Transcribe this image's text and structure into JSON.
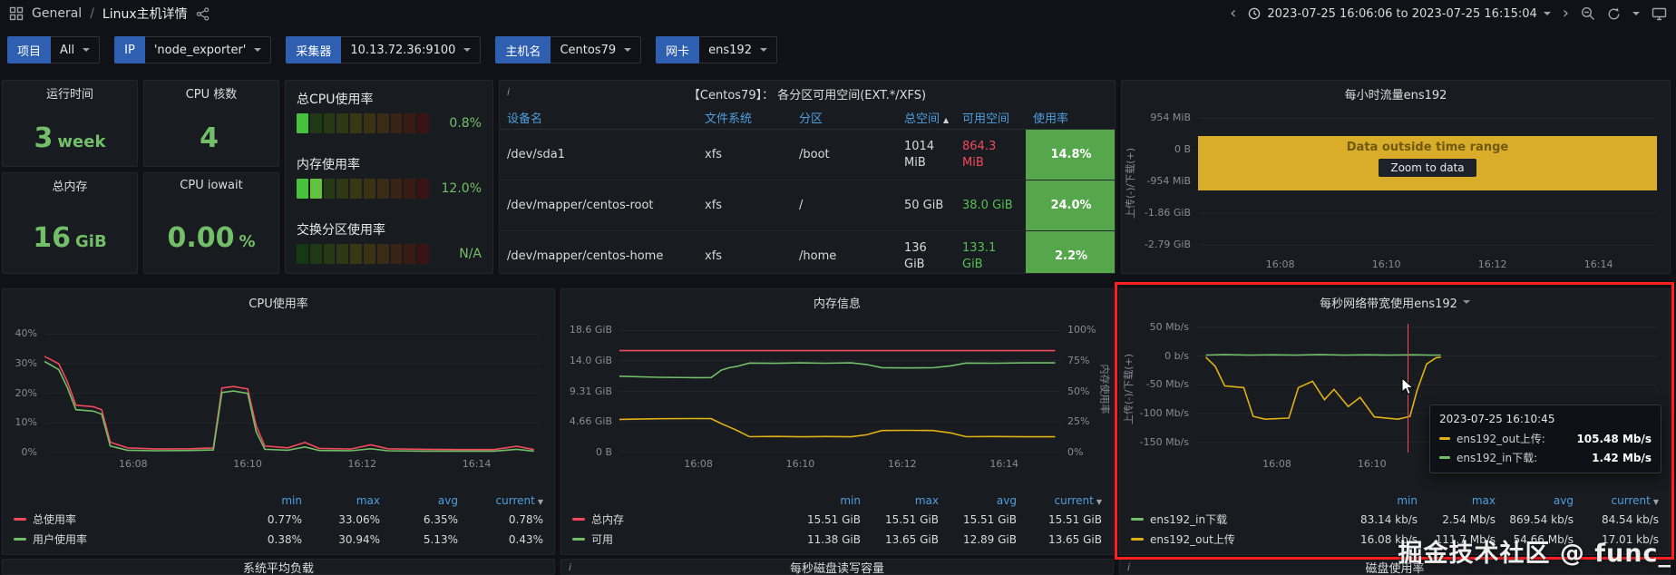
{
  "colors": {
    "red": "#f2495c",
    "green": "#73bf69",
    "yellow": "#e0b015",
    "value_green": "#56bf53",
    "value_red": "#f2495c",
    "usage_bg": "#56a64b",
    "header_blue": "#4f9ede",
    "filter_label_bg": "#2e5fb0",
    "band_bg": "#d9ad29",
    "highlight_red": "#ff1f1f"
  },
  "topbar": {
    "section": "General",
    "sep": "/",
    "page": "Linux主机详情",
    "time_range": "2023-07-25 16:06:06 to 2023-07-25 16:15:04"
  },
  "filters": [
    {
      "label": "项目",
      "value": "All"
    },
    {
      "label": "IP",
      "value": "'node_exporter'"
    },
    {
      "label": "采集器",
      "value": "10.13.72.36:9100"
    },
    {
      "label": "主机名",
      "value": "Centos79"
    },
    {
      "label": "网卡",
      "value": "ens192"
    }
  ],
  "stats": [
    {
      "title": "运行时间",
      "value": "3",
      "unit": "week"
    },
    {
      "title": "CPU 核数",
      "value": "4",
      "unit": ""
    },
    {
      "title": "总内存",
      "value": "16",
      "unit": "GiB"
    },
    {
      "title": "CPU iowait",
      "value": "0.00",
      "unit": "%"
    }
  ],
  "gauges": {
    "rows": [
      {
        "title": "总CPU使用率",
        "value": "0.8%",
        "pct": 0.8
      },
      {
        "title": "内存使用率",
        "value": "12.0%",
        "pct": 12.0
      },
      {
        "title": "交换分区使用率",
        "value": "N/A",
        "pct": 0
      }
    ]
  },
  "disk_table": {
    "title": "【Centos79】： 各分区可用空间(EXT.*/XFS)",
    "columns": [
      "设备名",
      "文件系统",
      "分区",
      "总空间",
      "可用空间",
      "使用率"
    ],
    "sorted_column_index": 3,
    "rows": [
      {
        "device": "/dev/sda1",
        "fs": "xfs",
        "mount": "/boot",
        "total": "1014 MiB",
        "avail": "864.3 MiB",
        "avail_color": "red",
        "usage": "14.8%"
      },
      {
        "device": "/dev/mapper/centos-root",
        "fs": "xfs",
        "mount": "/",
        "total": "50 GiB",
        "avail": "38.0 GiB",
        "avail_color": "green",
        "usage": "24.0%"
      },
      {
        "device": "/dev/mapper/centos-home",
        "fs": "xfs",
        "mount": "/home",
        "total": "136 GiB",
        "avail": "133.1 GiB",
        "avail_color": "green",
        "usage": "2.2%"
      }
    ]
  },
  "hourly_panel": {
    "title": "每小时流量ens192",
    "axis_label": "上传(-)/下载(+)",
    "overlay": {
      "message": "Data outside time range",
      "button": "Zoom to data"
    },
    "chart": {
      "type": "line",
      "x_range": [
        6.45,
        15.1
      ],
      "y_range": [
        -3100,
        1150
      ],
      "y_ticks": [
        {
          "label": "954 MiB",
          "v": 954
        },
        {
          "label": "0 B",
          "v": 0
        },
        {
          "label": "-954 MiB",
          "v": -954
        },
        {
          "label": "-1.86 GiB",
          "v": -1905
        },
        {
          "label": "-2.79 GiB",
          "v": -2857
        }
      ],
      "x_ticks": [
        {
          "label": "16:08",
          "v": 8
        },
        {
          "label": "16:10",
          "v": 10
        },
        {
          "label": "16:12",
          "v": 12
        },
        {
          "label": "16:14",
          "v": 14
        }
      ],
      "series": []
    }
  },
  "cpu_panel": {
    "title": "CPU使用率",
    "legend_columns": [
      "min",
      "max",
      "avg",
      "current"
    ],
    "legend": [
      {
        "name": "总使用率",
        "color": "red",
        "values": [
          "0.77%",
          "33.06%",
          "6.35%",
          "0.78%"
        ]
      },
      {
        "name": "用户使用率",
        "color": "green",
        "values": [
          "0.38%",
          "30.94%",
          "5.13%",
          "0.43%"
        ]
      }
    ],
    "chart": {
      "type": "line",
      "x_range": [
        6.45,
        15.1
      ],
      "y_range": [
        0,
        43.5
      ],
      "y_ticks": [
        {
          "label": "40%",
          "v": 40
        },
        {
          "label": "30%",
          "v": 30
        },
        {
          "label": "20%",
          "v": 20
        },
        {
          "label": "10%",
          "v": 10
        },
        {
          "label": "0%",
          "v": 0
        }
      ],
      "x_ticks": [
        {
          "label": "16:08",
          "v": 8
        },
        {
          "label": "16:10",
          "v": 10
        },
        {
          "label": "16:12",
          "v": 12
        },
        {
          "label": "16:14",
          "v": 14
        }
      ],
      "series": [
        {
          "color": "red",
          "points": [
            [
              6.45,
              32.5
            ],
            [
              6.7,
              30
            ],
            [
              6.85,
              24
            ],
            [
              7.0,
              16
            ],
            [
              7.3,
              15.5
            ],
            [
              7.45,
              14.5
            ],
            [
              7.6,
              3.5
            ],
            [
              7.9,
              1.6
            ],
            [
              8.4,
              1.2
            ],
            [
              9.0,
              1.3
            ],
            [
              9.4,
              1.6
            ],
            [
              9.55,
              21.8
            ],
            [
              9.75,
              22.3
            ],
            [
              10.0,
              21.5
            ],
            [
              10.15,
              9
            ],
            [
              10.3,
              2.2
            ],
            [
              10.7,
              1.6
            ],
            [
              11.0,
              3.4
            ],
            [
              11.25,
              1.4
            ],
            [
              11.8,
              1.2
            ],
            [
              12.15,
              2.6
            ],
            [
              12.45,
              1.3
            ],
            [
              13.1,
              1.1
            ],
            [
              13.7,
              1.0
            ],
            [
              14.3,
              1.0
            ],
            [
              14.7,
              2.1
            ],
            [
              15.0,
              1.0
            ]
          ]
        },
        {
          "color": "green",
          "points": [
            [
              6.45,
              30.8
            ],
            [
              6.7,
              28
            ],
            [
              6.85,
              22
            ],
            [
              7.0,
              14.5
            ],
            [
              7.3,
              14
            ],
            [
              7.45,
              13
            ],
            [
              7.6,
              2.2
            ],
            [
              7.9,
              0.8
            ],
            [
              8.4,
              0.6
            ],
            [
              9.0,
              0.7
            ],
            [
              9.4,
              0.9
            ],
            [
              9.55,
              20.3
            ],
            [
              9.75,
              20.8
            ],
            [
              10.0,
              20
            ],
            [
              10.15,
              7
            ],
            [
              10.3,
              1.1
            ],
            [
              10.7,
              0.8
            ],
            [
              11.0,
              1.9
            ],
            [
              11.25,
              0.7
            ],
            [
              11.8,
              0.6
            ],
            [
              12.15,
              1.3
            ],
            [
              12.45,
              0.6
            ],
            [
              13.1,
              0.5
            ],
            [
              13.7,
              0.5
            ],
            [
              14.3,
              0.5
            ],
            [
              14.7,
              1.1
            ],
            [
              15.0,
              0.5
            ]
          ]
        }
      ]
    }
  },
  "mem_panel": {
    "title": "内存信息",
    "y2_label": "内存使用率",
    "legend_columns": [
      "min",
      "max",
      "avg",
      "current"
    ],
    "legend": [
      {
        "name": "总内存",
        "color": "red",
        "values": [
          "15.51 GiB",
          "15.51 GiB",
          "15.51 GiB",
          "15.51 GiB"
        ]
      },
      {
        "name": "可用",
        "color": "green",
        "values": [
          "11.38 GiB",
          "13.65 GiB",
          "12.89 GiB",
          "13.65 GiB"
        ]
      }
    ],
    "chart": {
      "type": "line",
      "x_range": [
        6.45,
        15.1
      ],
      "y_range": [
        0,
        19.6
      ],
      "y_ticks": [
        {
          "label": "18.6 GiB",
          "v": 18.62
        },
        {
          "label": "14.0 GiB",
          "v": 13.97
        },
        {
          "label": "9.31 GiB",
          "v": 9.31
        },
        {
          "label": "4.66 GiB",
          "v": 4.66
        },
        {
          "label": "0 B",
          "v": 0
        }
      ],
      "y2_ticks": [
        "100%",
        "75%",
        "50%",
        "25%",
        "0%"
      ],
      "x_ticks": [
        {
          "label": "16:08",
          "v": 8
        },
        {
          "label": "16:10",
          "v": 10
        },
        {
          "label": "16:12",
          "v": 12
        },
        {
          "label": "16:14",
          "v": 14
        }
      ],
      "series": [
        {
          "color": "red",
          "points": [
            [
              6.45,
              15.51
            ],
            [
              15.0,
              15.51
            ]
          ]
        },
        {
          "color": "green",
          "points": [
            [
              6.45,
              11.62
            ],
            [
              7.2,
              11.45
            ],
            [
              7.9,
              11.4
            ],
            [
              8.25,
              11.42
            ],
            [
              8.45,
              12.55
            ],
            [
              8.6,
              12.9
            ],
            [
              8.75,
              13.1
            ],
            [
              9.0,
              13.62
            ],
            [
              9.5,
              13.58
            ],
            [
              10.0,
              13.65
            ],
            [
              10.5,
              13.6
            ],
            [
              11.0,
              13.65
            ],
            [
              11.3,
              13.4
            ],
            [
              11.6,
              12.92
            ],
            [
              12.1,
              12.88
            ],
            [
              12.6,
              12.9
            ],
            [
              12.95,
              13.2
            ],
            [
              13.25,
              13.62
            ],
            [
              13.8,
              13.6
            ],
            [
              14.4,
              13.65
            ],
            [
              15.0,
              13.65
            ]
          ]
        },
        {
          "color": "yellow",
          "points": [
            [
              6.45,
              5.05
            ],
            [
              7.2,
              5.15
            ],
            [
              7.9,
              5.18
            ],
            [
              8.25,
              5.16
            ],
            [
              8.45,
              4.4
            ],
            [
              8.6,
              3.9
            ],
            [
              8.75,
              3.4
            ],
            [
              9.0,
              2.42
            ],
            [
              9.5,
              2.46
            ],
            [
              10.0,
              2.4
            ],
            [
              10.5,
              2.44
            ],
            [
              11.0,
              2.4
            ],
            [
              11.3,
              2.7
            ],
            [
              11.6,
              3.35
            ],
            [
              12.1,
              3.38
            ],
            [
              12.6,
              3.35
            ],
            [
              12.95,
              3.0
            ],
            [
              13.25,
              2.42
            ],
            [
              13.8,
              2.45
            ],
            [
              14.4,
              2.4
            ],
            [
              15.0,
              2.4
            ]
          ]
        }
      ]
    }
  },
  "net_panel": {
    "title": "每秒网络带宽使用ens192",
    "axis_label": "上传(-)/下载(+)",
    "legend_columns": [
      "min",
      "max",
      "avg",
      "current"
    ],
    "legend": [
      {
        "name": "ens192_in下载",
        "color": "green",
        "values": [
          "83.14 kb/s",
          "2.54 Mb/s",
          "869.54 kb/s",
          "84.54 kb/s"
        ]
      },
      {
        "name": "ens192_out上传",
        "color": "yellow",
        "values": [
          "16.08 kb/s",
          "111.7 Mb/s",
          "54.66 Mb/s",
          "17.01 kb/s"
        ]
      }
    ],
    "tooltip": {
      "time": "2023-07-25 16:10:45",
      "rows": [
        {
          "name": "ens192_out上传:",
          "value": "105.48 Mb/s",
          "color": "yellow"
        },
        {
          "name": "ens192_in下载:",
          "value": "1.42 Mb/s",
          "color": "green"
        }
      ]
    },
    "chart": {
      "type": "line",
      "x_range": [
        6.3,
        16.0
      ],
      "y_range": [
        -168,
        56
      ],
      "y_ticks": [
        {
          "label": "50 Mb/s",
          "v": 50
        },
        {
          "label": "0 b/s",
          "v": 0
        },
        {
          "label": "-50 Mb/s",
          "v": -50
        },
        {
          "label": "-100 Mb/s",
          "v": -100
        },
        {
          "label": "-150 Mb/s",
          "v": -150
        }
      ],
      "x_ticks": [
        {
          "label": "16:08",
          "v": 8
        },
        {
          "label": "16:10",
          "v": 10
        }
      ],
      "cursor_x": 10.75,
      "series": [
        {
          "color": "yellow",
          "points": [
            [
              6.5,
              -2
            ],
            [
              6.7,
              -18
            ],
            [
              6.9,
              -52
            ],
            [
              7.3,
              -55
            ],
            [
              7.5,
              -105
            ],
            [
              7.75,
              -110
            ],
            [
              8.25,
              -108
            ],
            [
              8.45,
              -55
            ],
            [
              8.75,
              -44
            ],
            [
              9.0,
              -76
            ],
            [
              9.2,
              -58
            ],
            [
              9.5,
              -88
            ],
            [
              9.75,
              -72
            ],
            [
              10.05,
              -106
            ],
            [
              10.55,
              -110
            ],
            [
              10.8,
              -105
            ],
            [
              10.95,
              -60
            ],
            [
              11.15,
              -14
            ],
            [
              11.35,
              -3
            ],
            [
              11.45,
              -2
            ]
          ]
        },
        {
          "color": "green",
          "points": [
            [
              6.5,
              1.5
            ],
            [
              6.9,
              2.5
            ],
            [
              7.4,
              1.5
            ],
            [
              7.9,
              2
            ],
            [
              8.4,
              1.5
            ],
            [
              8.9,
              2.5
            ],
            [
              9.4,
              1.5
            ],
            [
              9.9,
              2
            ],
            [
              10.4,
              1.5
            ],
            [
              10.9,
              2
            ],
            [
              11.2,
              1.5
            ],
            [
              11.45,
              1.5
            ]
          ]
        }
      ]
    }
  },
  "bottom_panels": [
    {
      "title": "系统平均负载"
    },
    {
      "title": "每秒磁盘读写容量"
    },
    {
      "title": "磁盘使用率"
    }
  ],
  "watermark": "掘金技术社区 @ func_"
}
